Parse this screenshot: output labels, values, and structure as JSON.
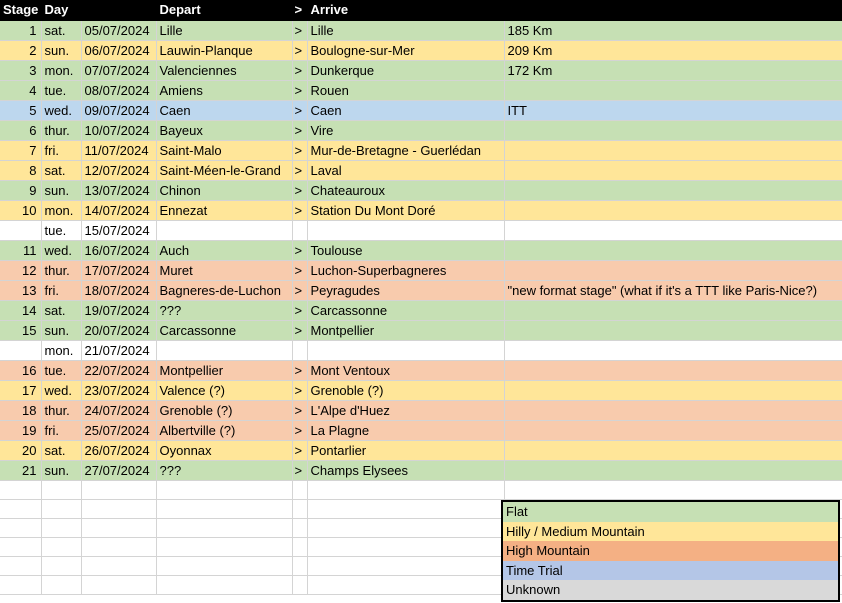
{
  "headers": {
    "stage": "Stage",
    "day": "Day",
    "depart": "Depart",
    "arrow": ">",
    "arrive": "Arrive"
  },
  "rows": [
    {
      "stage": "1",
      "day": "sat.",
      "date": "05/07/2024",
      "depart": "Lille",
      "arrow": ">",
      "arrive": "Lille",
      "note": "185 Km",
      "type": "flat"
    },
    {
      "stage": "2",
      "day": "sun.",
      "date": "06/07/2024",
      "depart": "Lauwin-Planque",
      "arrow": ">",
      "arrive": "Boulogne-sur-Mer",
      "note": "209 Km",
      "type": "hilly"
    },
    {
      "stage": "3",
      "day": "mon.",
      "date": "07/07/2024",
      "depart": "Valenciennes",
      "arrow": ">",
      "arrive": "Dunkerque",
      "note": "172 Km",
      "type": "flat"
    },
    {
      "stage": "4",
      "day": "tue.",
      "date": "08/07/2024",
      "depart": "Amiens",
      "arrow": ">",
      "arrive": "Rouen",
      "note": "",
      "type": "flat"
    },
    {
      "stage": "5",
      "day": "wed.",
      "date": "09/07/2024",
      "depart": "Caen",
      "arrow": ">",
      "arrive": "Caen",
      "note": "ITT",
      "type": "tt"
    },
    {
      "stage": "6",
      "day": "thur.",
      "date": "10/07/2024",
      "depart": "Bayeux",
      "arrow": ">",
      "arrive": "Vire",
      "note": "",
      "type": "flat"
    },
    {
      "stage": "7",
      "day": "fri.",
      "date": "11/07/2024",
      "depart": "Saint-Malo",
      "arrow": ">",
      "arrive": "Mur-de-Bretagne - Guerlédan",
      "note": "",
      "type": "hilly"
    },
    {
      "stage": "8",
      "day": "sat.",
      "date": "12/07/2024",
      "depart": "Saint-Méen-le-Grand",
      "arrow": ">",
      "arrive": "Laval",
      "note": "",
      "type": "hilly"
    },
    {
      "stage": "9",
      "day": "sun.",
      "date": "13/07/2024",
      "depart": "Chinon",
      "arrow": ">",
      "arrive": "Chateauroux",
      "note": "",
      "type": "flat"
    },
    {
      "stage": "10",
      "day": "mon.",
      "date": "14/07/2024",
      "depart": "Ennezat",
      "arrow": ">",
      "arrive": "Station Du Mont Doré",
      "note": "",
      "type": "hilly"
    },
    {
      "stage": "",
      "day": "tue.",
      "date": "15/07/2024",
      "depart": "",
      "arrow": "",
      "arrive": "",
      "note": "",
      "type": "rest"
    },
    {
      "stage": "11",
      "day": "wed.",
      "date": "16/07/2024",
      "depart": "Auch",
      "arrow": ">",
      "arrive": "Toulouse",
      "note": "",
      "type": "flat"
    },
    {
      "stage": "12",
      "day": "thur.",
      "date": "17/07/2024",
      "depart": "Muret",
      "arrow": ">",
      "arrive": "Luchon-Superbagneres",
      "note": "",
      "type": "high"
    },
    {
      "stage": "13",
      "day": "fri.",
      "date": "18/07/2024",
      "depart": "Bagneres-de-Luchon",
      "arrow": ">",
      "arrive": "Peyragudes",
      "note": "\"new format stage\" (what if it's a TTT like Paris-Nice?)",
      "type": "high"
    },
    {
      "stage": "14",
      "day": "sat.",
      "date": "19/07/2024",
      "depart": "???",
      "arrow": ">",
      "arrive": "Carcassonne",
      "note": "",
      "type": "flat"
    },
    {
      "stage": "15",
      "day": "sun.",
      "date": "20/07/2024",
      "depart": "Carcassonne",
      "arrow": ">",
      "arrive": "Montpellier",
      "note": "",
      "type": "flat"
    },
    {
      "stage": "",
      "day": "mon.",
      "date": "21/07/2024",
      "depart": "",
      "arrow": "",
      "arrive": "",
      "note": "",
      "type": "rest"
    },
    {
      "stage": "16",
      "day": "tue.",
      "date": "22/07/2024",
      "depart": "Montpellier",
      "arrow": ">",
      "arrive": "Mont Ventoux",
      "note": "",
      "type": "high"
    },
    {
      "stage": "17",
      "day": "wed.",
      "date": "23/07/2024",
      "depart": "Valence (?)",
      "arrow": ">",
      "arrive": "Grenoble (?)",
      "note": "",
      "type": "hilly"
    },
    {
      "stage": "18",
      "day": "thur.",
      "date": "24/07/2024",
      "depart": "Grenoble (?)",
      "arrow": ">",
      "arrive": "L'Alpe d'Huez",
      "note": "",
      "type": "high"
    },
    {
      "stage": "19",
      "day": "fri.",
      "date": "25/07/2024",
      "depart": "Albertville (?)",
      "arrow": ">",
      "arrive": "La Plagne",
      "note": "",
      "type": "high"
    },
    {
      "stage": "20",
      "day": "sat.",
      "date": "26/07/2024",
      "depart": "Oyonnax",
      "arrow": ">",
      "arrive": "Pontarlier",
      "note": "",
      "type": "hilly"
    },
    {
      "stage": "21",
      "day": "sun.",
      "date": "27/07/2024",
      "depart": "???",
      "arrow": ">",
      "arrive": "Champs Elysees",
      "note": "",
      "type": "flat"
    }
  ],
  "legend": [
    {
      "label": "Flat",
      "type": "flat"
    },
    {
      "label": "Hilly / Medium Mountain",
      "type": "hilly"
    },
    {
      "label": "High Mountain",
      "type": "high"
    },
    {
      "label": "Time Trial",
      "type": "tt"
    },
    {
      "label": "Unknown",
      "type": "unknown"
    }
  ],
  "colors": {
    "flat": "#c6e0b4",
    "hilly": "#ffe699",
    "high_mountain": "#f8cbad",
    "time_trial": "#bdd7ee",
    "unknown": "#d9d9d9",
    "header": "#000000"
  }
}
